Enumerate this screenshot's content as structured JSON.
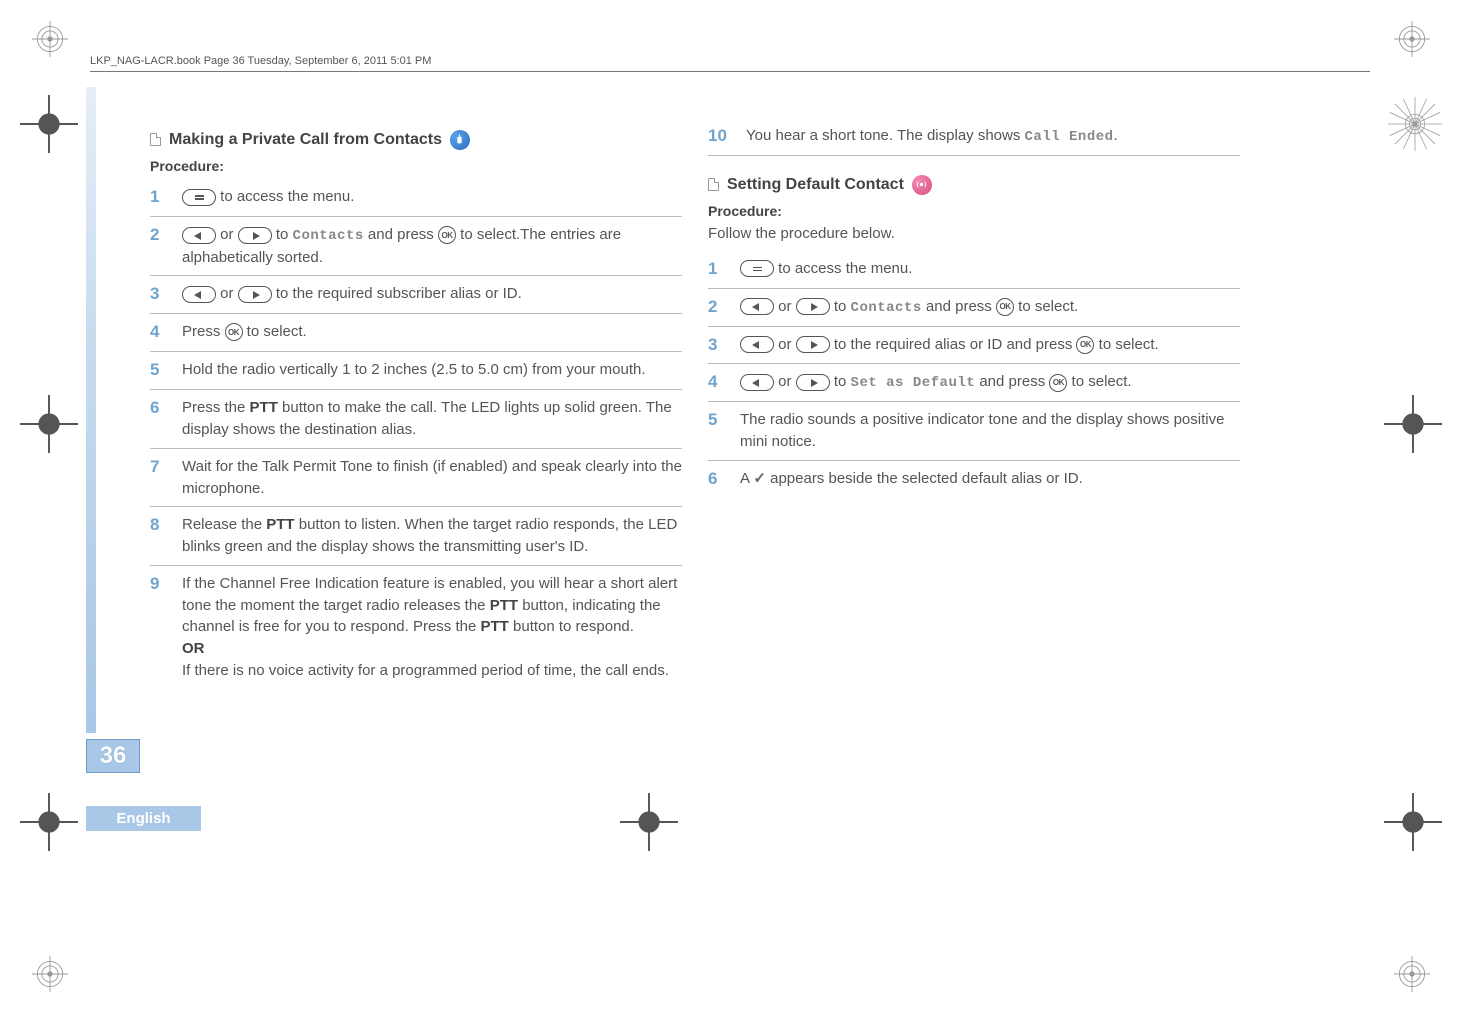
{
  "print_line": "LKP_NAG-LACR.book  Page 36  Tuesday, September 6, 2011  5:01 PM",
  "page_number": "36",
  "language": "English",
  "left": {
    "heading": "Making a Private Call from Contacts",
    "procedure_label": "Procedure:",
    "steps": {
      "s1_a": " to access the menu.",
      "s2_a": " or ",
      "s2_b": " to ",
      "s2_contacts": "Contacts",
      "s2_c": " and press ",
      "s2_d": " to select.The entries are alphabetically sorted.",
      "s3_a": " or ",
      "s3_b": " to the required subscriber alias or ID.",
      "s4_a": "Press ",
      "s4_b": " to select.",
      "s5": "Hold the radio vertically 1 to 2 inches (2.5 to 5.0 cm) from your mouth.",
      "s6_a": "Press the ",
      "s6_ptt": "PTT",
      "s6_b": " button to make the call. The LED lights up solid green. The display shows the destination alias.",
      "s7": "Wait for the Talk Permit Tone to finish (if enabled) and speak clearly into the microphone.",
      "s8_a": "Release the ",
      "s8_b": " button to listen. When the target radio responds, the LED blinks green and the display shows the transmitting user's ID.",
      "s9_a": "If the Channel Free Indication feature is enabled, you will hear a short alert tone the moment the target radio releases the ",
      "s9_b": " button, indicating the channel is free for you to respond. Press the ",
      "s9_c": " button to respond.",
      "s9_or": "OR",
      "s9_d": "If there is no voice activity for a programmed period of time, the call ends.",
      "s10_a": "You hear a short tone. The display shows ",
      "s10_call_ended": "Call Ended",
      "s10_b": "."
    },
    "nums": {
      "n1": "1",
      "n2": "2",
      "n3": "3",
      "n4": "4",
      "n5": "5",
      "n6": "6",
      "n7": "7",
      "n8": "8",
      "n9": "9",
      "n10": "10"
    }
  },
  "right": {
    "heading": "Setting Default Contact",
    "procedure_label": "Procedure:",
    "procedure_desc": "Follow the procedure below.",
    "steps": {
      "s1_a": " to access the menu.",
      "s2_a": " or ",
      "s2_b": " to ",
      "s2_contacts": "Contacts",
      "s2_c": " and press ",
      "s2_d": " to select.",
      "s3_a": " or ",
      "s3_b": " to the required alias or ID and press ",
      "s3_c": " to select.",
      "s4_a": " or ",
      "s4_b": " to ",
      "s4_set": "Set as Default",
      "s4_c": " and press ",
      "s4_d": " to select.",
      "s5": "The radio sounds a positive indicator tone and the display shows positive mini notice.",
      "s6_a": "A ",
      "s6_b": " appears beside the selected default alias or ID."
    },
    "nums": {
      "n1": "1",
      "n2": "2",
      "n3": "3",
      "n4": "4",
      "n5": "5",
      "n6": "6"
    }
  }
}
